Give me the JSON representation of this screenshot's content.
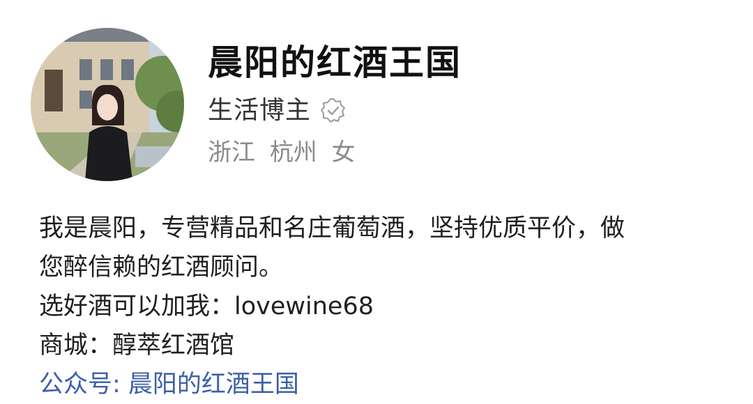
{
  "profile": {
    "name": "晨阳的红酒王国",
    "role": "生活博主",
    "verified_icon": "verified-badge-icon",
    "location_province": "浙江",
    "location_city": "杭州",
    "gender": "女"
  },
  "bio": {
    "line1": "我是晨阳，专营精品和名庄葡萄酒，坚持优质平价，做",
    "line2": "您醉信赖的红酒顾问。",
    "line3": "选好酒可以加我：lovewine68",
    "line4": "商城：醇萃红酒馆",
    "line5": "公众号: 晨阳的红酒王国"
  },
  "colors": {
    "link": "#3b5fa8",
    "meta_gray": "#8a8a8a"
  }
}
